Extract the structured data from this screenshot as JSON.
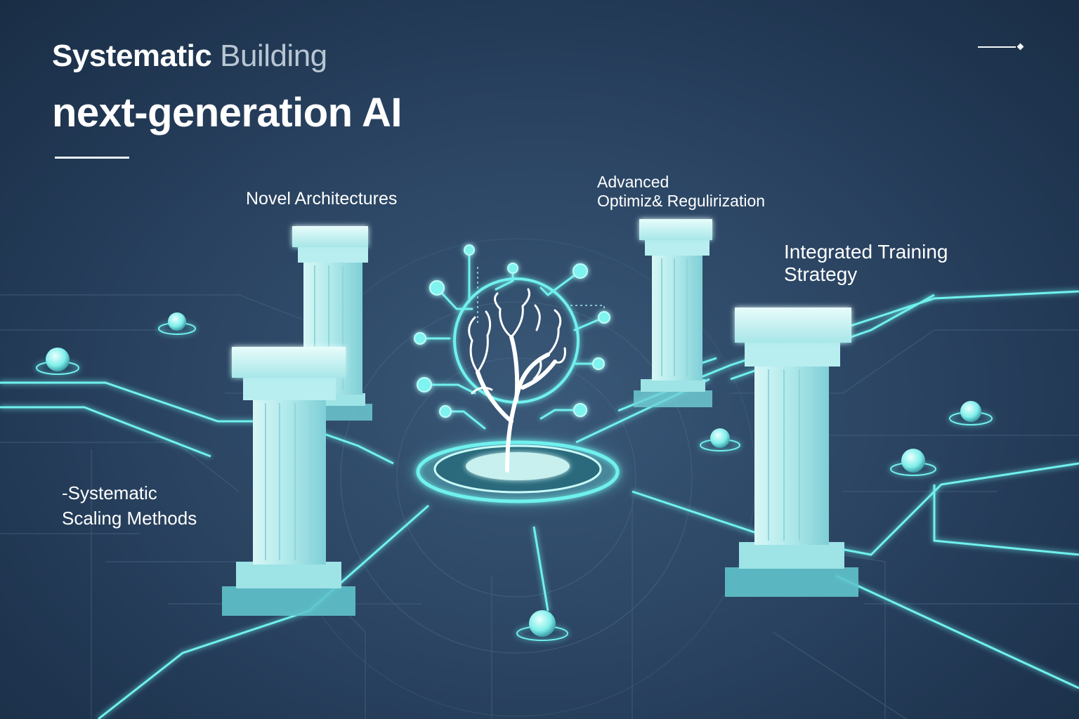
{
  "header": {
    "title_line1_strong": "Systematic",
    "title_line1_light": "Building",
    "title_line2": "next-generation AI"
  },
  "pillars": {
    "architectures": "Novel Architectures",
    "optimization_line1": "Advanced",
    "optimization_line2": "Optimiz& Regulirization",
    "training_line1": "Integrated Training",
    "training_line2": "Strategy",
    "scaling_line1": "-Systematic",
    "scaling_line2": "Scaling Methods"
  },
  "colors": {
    "background": "#2b4563",
    "glow": "#6ff1ee",
    "pillar": "#bfeff0",
    "text": "#ffffff"
  },
  "icons": [
    "brain-tree-icon",
    "corner-arrow-icon"
  ]
}
